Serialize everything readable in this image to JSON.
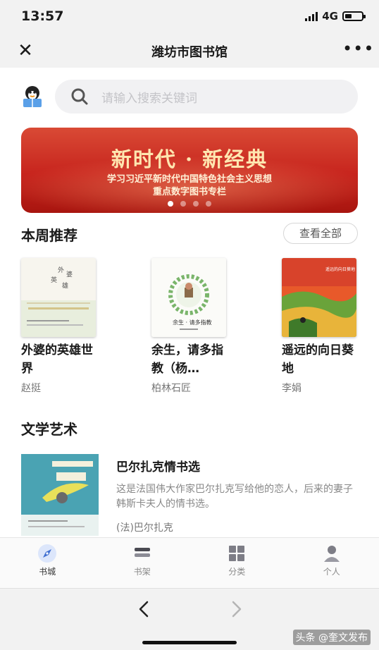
{
  "status_bar": {
    "time": "13:57",
    "network": "4G"
  },
  "nav": {
    "title": "潍坊市图书馆"
  },
  "search": {
    "placeholder": "请输入搜索关键词"
  },
  "banner": {
    "title": "新时代 · 新经典",
    "subtitle_line1": "学习习近平新时代中国特色社会主义思想",
    "subtitle_line2": "重点数字图书专栏",
    "slide_count": 4,
    "active_slide": 1
  },
  "weekly": {
    "title": "本周推荐",
    "view_all": "查看全部",
    "books": [
      {
        "title": "外婆的英雄世界",
        "author": "赵挺"
      },
      {
        "title": "余生，请多指教（杨…",
        "author": "柏林石匠"
      },
      {
        "title": "遥远的向日葵地",
        "author": "李娟"
      }
    ]
  },
  "literature": {
    "title": "文学艺术",
    "item": {
      "title": "巴尔扎克情书选",
      "description": "这是法国伟大作家巴尔扎克写给他的恋人，后来的妻子韩斯卡夫人的情书选。",
      "author": "(法)巴尔扎克"
    }
  },
  "tabs": [
    {
      "label": "书城",
      "active": true
    },
    {
      "label": "书架",
      "active": false
    },
    {
      "label": "分类",
      "active": false
    },
    {
      "label": "个人",
      "active": false
    }
  ],
  "watermark": "头条 @奎文发布",
  "colors": {
    "accent_blue": "#3f6fd1",
    "banner_red": "#c7241d",
    "banner_gold": "#ffe6b0"
  }
}
